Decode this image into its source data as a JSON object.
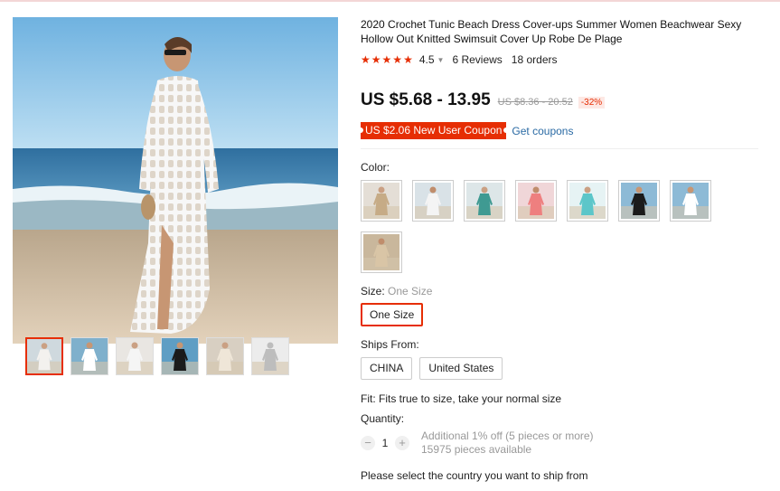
{
  "product": {
    "title": "2020 Crochet Tunic Beach Dress Cover-ups Summer Women Beachwear Sexy Hollow Out Knitted Swimsuit Cover Up Robe De Plage",
    "rating": "4.5",
    "stars": 5,
    "reviews": "6 Reviews",
    "orders": "18 orders"
  },
  "price": {
    "current": "US $5.68 - 13.95",
    "original": "US $8.36 - 20.52",
    "discount": "-32%"
  },
  "coupon": {
    "label": "US $2.06 New User Coupon",
    "link": "Get coupons"
  },
  "color": {
    "label": "Color:",
    "swatch_count": 8
  },
  "size": {
    "label": "Size:",
    "value": "One Size",
    "option": "One Size"
  },
  "ships": {
    "label": "Ships From:",
    "options": [
      "CHINA",
      "United States"
    ]
  },
  "fit": "Fit: Fits true to size, take your normal size",
  "quantity": {
    "label": "Quantity:",
    "value": "1",
    "minus": "−",
    "plus": "+",
    "discount_note": "Additional 1% off (5 pieces or more)",
    "available": "15975 pieces available"
  },
  "shipping_note": "Please select the country you want to ship from",
  "colors": {
    "accent": "#e62e04",
    "link": "#2a6aa4",
    "sky": "#8fc3e8",
    "sea": "#3f7fb0",
    "sand": "#d9c3a4"
  },
  "gallery": {
    "thumb_count": 6,
    "active_thumb": 0
  }
}
